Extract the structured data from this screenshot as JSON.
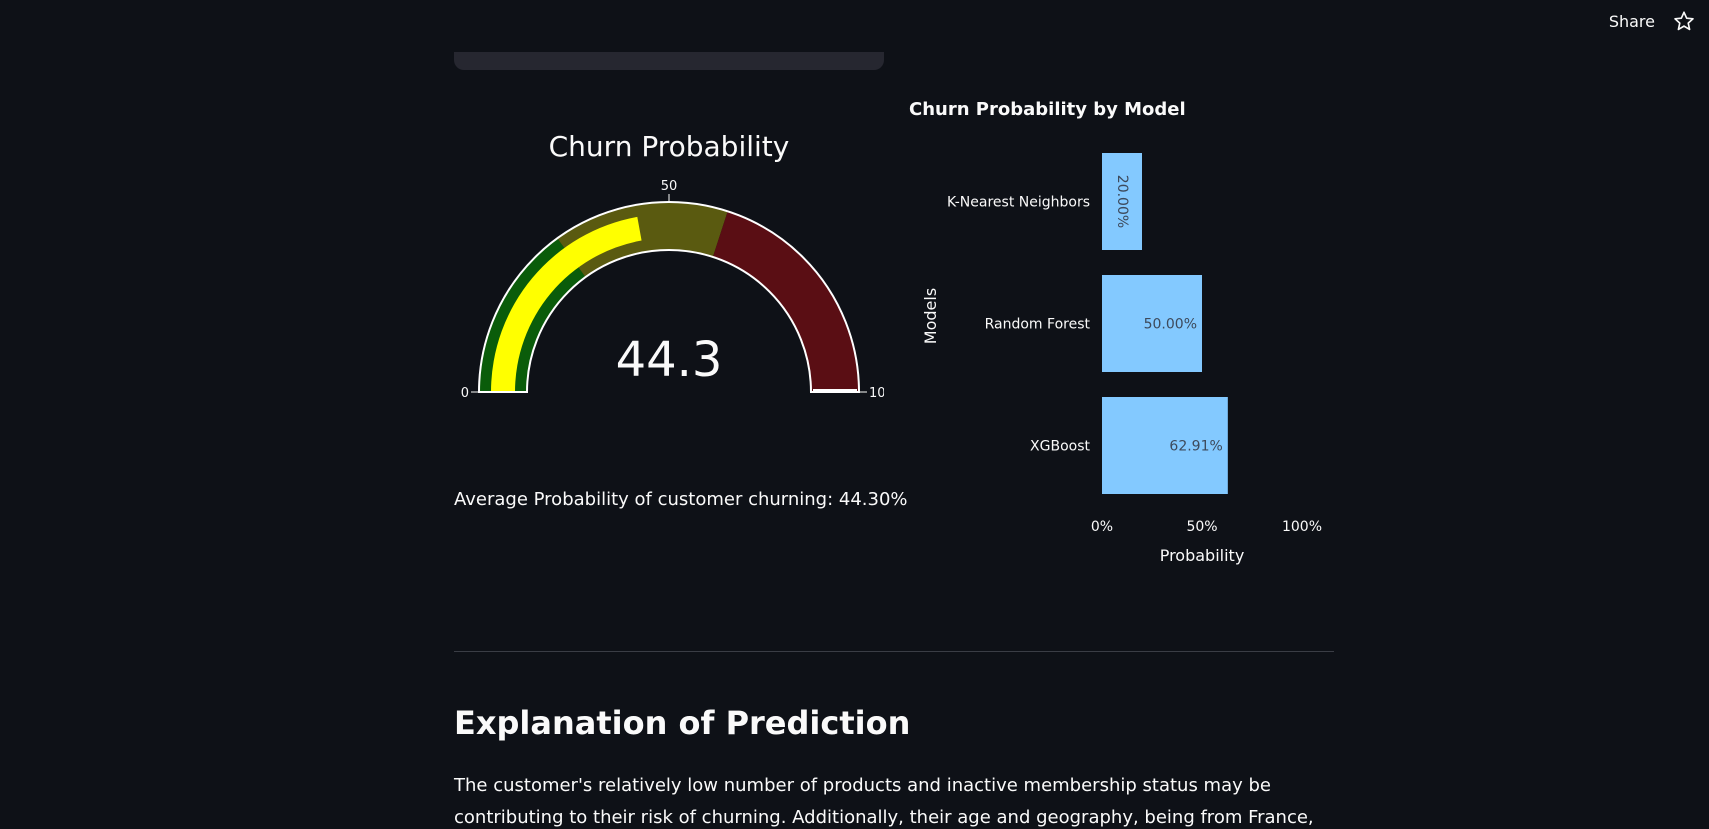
{
  "header": {
    "share_label": "Share",
    "star_icon": "star-outline-icon"
  },
  "gauge": {
    "title": "Churn Probability",
    "value": 44.3,
    "value_text": "44.3",
    "min_label": "0",
    "mid_label": "50",
    "max_label": "10",
    "min": 0,
    "max": 100,
    "threshold": 100,
    "steps": [
      {
        "from": 0,
        "to": 30,
        "color": "#0a5c0a"
      },
      {
        "from": 30,
        "to": 60,
        "color": "#5a5a10"
      },
      {
        "from": 60,
        "to": 100,
        "color": "#5a0e14"
      }
    ],
    "bar_color": "#ffff00"
  },
  "avg_text": "Average Probability of customer churning: 44.30%",
  "chart_data": {
    "type": "bar",
    "orientation": "horizontal",
    "title": "Churn Probability by Model",
    "xlabel": "Probability",
    "ylabel": "Models",
    "categories": [
      "K-Nearest Neighbors",
      "Random Forest",
      "XGBoost"
    ],
    "values": [
      0.2,
      0.5,
      0.6291
    ],
    "value_labels": [
      "20.00%",
      "50.00%",
      "62.91%"
    ],
    "xlim": [
      0,
      1
    ],
    "xticks": [
      0,
      0.5,
      1
    ],
    "xtick_labels": [
      "0%",
      "50%",
      "100%"
    ],
    "bar_color": "#83c9ff",
    "grid": false
  },
  "section": {
    "title": "Explanation of Prediction",
    "text": "The customer's relatively low number of products and inactive membership status may be contributing to their risk of churning. Additionally, their age and geography, being from France, are also factors that are"
  }
}
